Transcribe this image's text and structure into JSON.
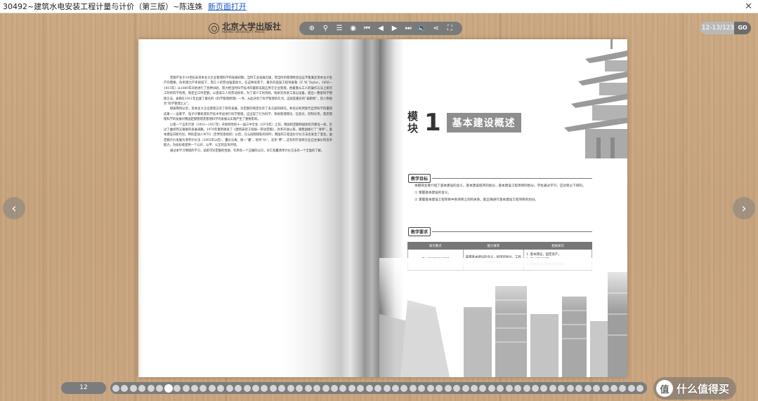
{
  "window": {
    "title": "30492~建筑水电安装工程计量与计价（第三版）~陈连姝",
    "link": "新页面打开",
    "close_icon": "close-icon"
  },
  "toolbar": {
    "logo_text": "北京大学出版社",
    "logo_subtext": "PEKING UNIVERSITY PRESS",
    "buttons": [
      {
        "name": "zoom-in-icon",
        "glyph": "⊕"
      },
      {
        "name": "search-icon",
        "glyph": "⚲"
      },
      {
        "name": "list-icon",
        "glyph": "☰"
      },
      {
        "name": "autoplay-icon",
        "glyph": "◉"
      },
      {
        "name": "first-page-icon",
        "glyph": "⏮"
      },
      {
        "name": "prev-page-icon",
        "glyph": "◀"
      },
      {
        "name": "next-page-icon",
        "glyph": "▶"
      },
      {
        "name": "last-page-icon",
        "glyph": "⏭"
      },
      {
        "name": "sound-icon",
        "glyph": "🔈"
      },
      {
        "name": "share-icon",
        "glyph": "⋖"
      },
      {
        "name": "fullscreen-icon",
        "glyph": "⛶"
      }
    ],
    "page_indicator": "12-13/123",
    "go_label": "GO"
  },
  "nav": {
    "prev_icon": "‹",
    "next_icon": "›"
  },
  "left_page": {
    "paragraphs": [
      "定额产生于19世纪末资本主义企业管理科学的发展初期，当时工业发展迅速，而当时的管理经验远远不能满足资本主义生产的需要，效率潜力产率很低下，而工人的劳动强度很大。在这种背景下，著名的美国工程师泰勒（F. W. Taylor，1856—1915年）从1880年开始进行了各种试验，努力把当时科学技术的最新成就应用于企业管理，他着重从工人的操作方法上研究工时的科学利用，制定出工时定额，以提高工人的劳动效率。为了减少工时消耗，他研究改进工具与设备，提出一整套科学管理方法。泰勒在1911年出版了著名的《科学管理原理》一书，从此开创了科学管理的先河，这就是著名的“泰勒制”，后人称他为“科学管理之父”。",
      "继泰勒制以后，资本主义企业管理又有了新的发展，对定额的制定也有了多方面的研究。并充分利用现代自然科学的最新成果——运筹学、电子计算机等科学技术手段进行科学管理，这出现了行为科学、系统管理理论、信息论、控制论等，而后管理科学的发展对我国定额管理及管理科学的发展与实践产生了重要影响。",
      "以第一个五年计划（1953—1957年）开始到党的十一届三中全会（1978年）之前，我国的定额和国民经济建设一样，走过了曲折而又艰难的发展道路。1979年重新颁发了《建筑安装工程统一劳动定额》，改革开放以来，随我国推行了“清单”，基本建设日新月异。特别是加入WTO（世界贸易组织）以后，在与国际接轨的同时，我国的工程造价计价方法也发生了变化，由定额计价发展为清单计价法（2003年以后），量价分离，统一“量”，指导“价”，竞争“费”，这有利于发挥企业自主报价的竞争能力，为投标者提供一个公开、公平、公正的竞争环境。",
      "通过本学习情境的学习，读者可对定额的性质、作用有一个正确的认识，对工程量清单计价方法有一个全面的了解。"
    ]
  },
  "right_page": {
    "module_label": "模块",
    "module_number": "1",
    "module_title": "基本建设概述",
    "objectives_heading": "教学目标",
    "objectives": [
      "本模块主要介绍了基本建设的含义，基本建设程序的划分，基本建设工程项目的划分。学生通过学习，应达到以下目的。",
      "① 掌握基本建设的含义。",
      "② 掌握基本建设工程项目中各项目之间的关系，能正确进行基本建设工程项目的划分。"
    ],
    "requirements_heading": "教学要求",
    "table": {
      "headers": [
        "知识要点",
        "能力要求",
        "相关知识"
      ],
      "rows": [
        [
          "基本建设的相关知识",
          "掌握基本建设的含义，程序的划分，工程项目的划分",
          "1. 基本建设，固定资产；\n2. 基本建设程序；\n3. 基本建设工程项目的划分"
        ]
      ]
    }
  },
  "footer": {
    "page_number": "12",
    "dot_count": 61,
    "active_dot": 6,
    "watermark_text": "什么值得买",
    "watermark_icon": "值"
  }
}
